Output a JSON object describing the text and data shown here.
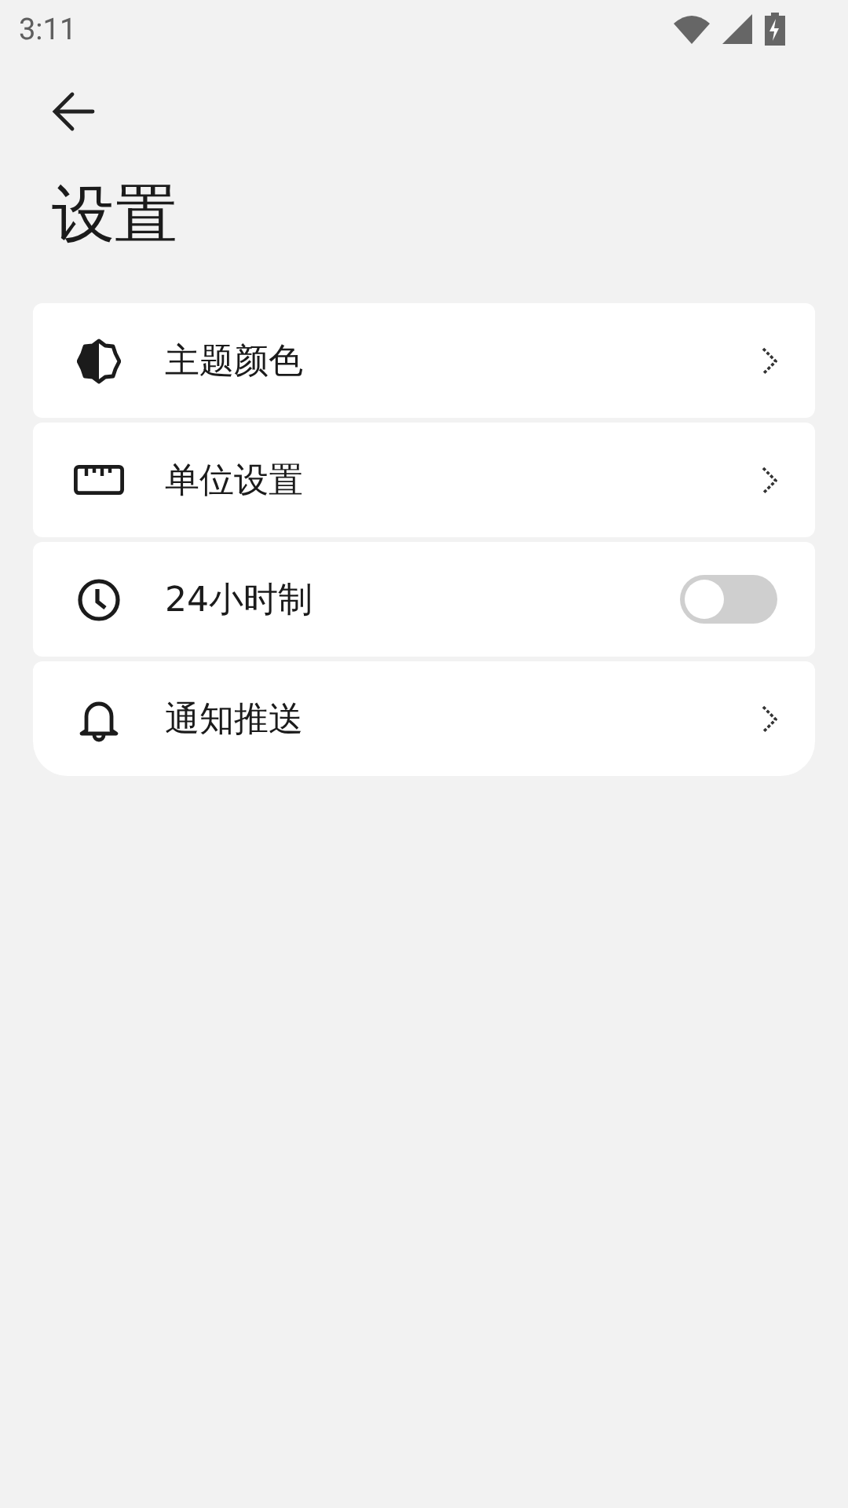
{
  "status_bar": {
    "time": "3:11"
  },
  "header": {
    "title": "设置"
  },
  "settings": [
    {
      "label": "主题颜色",
      "kind": "link"
    },
    {
      "label": "单位设置",
      "kind": "link"
    },
    {
      "label": "24小时制",
      "kind": "switch",
      "on": false
    },
    {
      "label": "通知推送",
      "kind": "link"
    }
  ]
}
